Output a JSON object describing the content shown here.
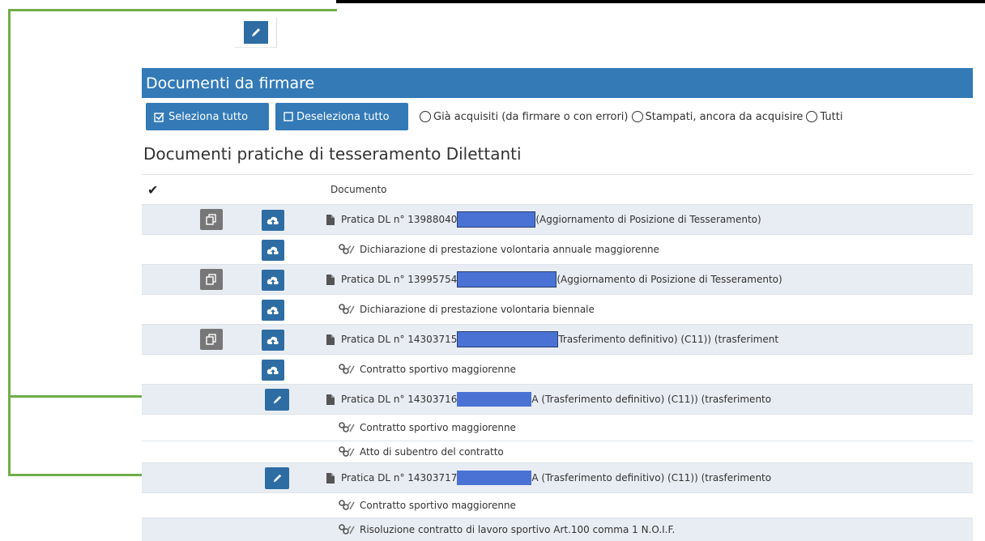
{
  "panel": {
    "title": "Documenti da firmare"
  },
  "toolbar": {
    "select_all": "Seleziona tutto",
    "deselect_all": "Deseleziona tutto",
    "radios": [
      "Già acquisiti (da firmare o con errori)",
      "Stampati, ancora da acquisire",
      "Tutti"
    ]
  },
  "section": {
    "title": "Documenti pratiche di tesseramento Dilettanti"
  },
  "table": {
    "header_check": "✔",
    "header_doc": "Documento",
    "rows": [
      {
        "kind": "pratica",
        "prefix": "Pratica DL n° 13988040",
        "suffix": "(Aggiornamento di Posizione di Tesseramento)"
      },
      {
        "kind": "child",
        "text": "Dichiarazione di prestazione volontaria annuale maggiorenne"
      },
      {
        "kind": "pratica",
        "prefix": "Pratica DL n° 13995754",
        "suffix": "(Aggiornamento di Posizione di Tesseramento)"
      },
      {
        "kind": "child",
        "text": "Dichiarazione di prestazione volontaria biennale"
      },
      {
        "kind": "pratica",
        "prefix": "Pratica DL n° 14303715",
        "suffix": "Trasferimento definitivo) (C11)) (trasferiment"
      },
      {
        "kind": "child",
        "text": "Contratto sportivo maggiorenne"
      },
      {
        "kind": "pratica-edit",
        "prefix": "Pratica DL n° 14303716",
        "suffix": "A (Trasferimento definitivo) (C11)) (trasferimento"
      },
      {
        "kind": "child",
        "text": "Contratto sportivo maggiorenne"
      },
      {
        "kind": "child",
        "text": "Atto di subentro del contratto"
      },
      {
        "kind": "pratica-edit",
        "prefix": "Pratica DL n° 14303717",
        "suffix": "A (Trasferimento definitivo) (C11)) (trasferimento"
      },
      {
        "kind": "child",
        "text": "Contratto sportivo maggiorenne"
      },
      {
        "kind": "child",
        "text": "Risoluzione contratto di lavoro sportivo Art.100 comma 1 N.O.I.F."
      }
    ]
  },
  "icons": {
    "edit": "pencil-icon",
    "copy": "copy-icon",
    "upload": "cloud-upload-icon",
    "file": "file-icon",
    "attach": "paperclip-icon",
    "link": "link-icon"
  },
  "colors": {
    "primary": "#337ab7",
    "row_alt": "#e8edf3",
    "arrow": "#70ad47",
    "copy_btn": "#777777"
  }
}
